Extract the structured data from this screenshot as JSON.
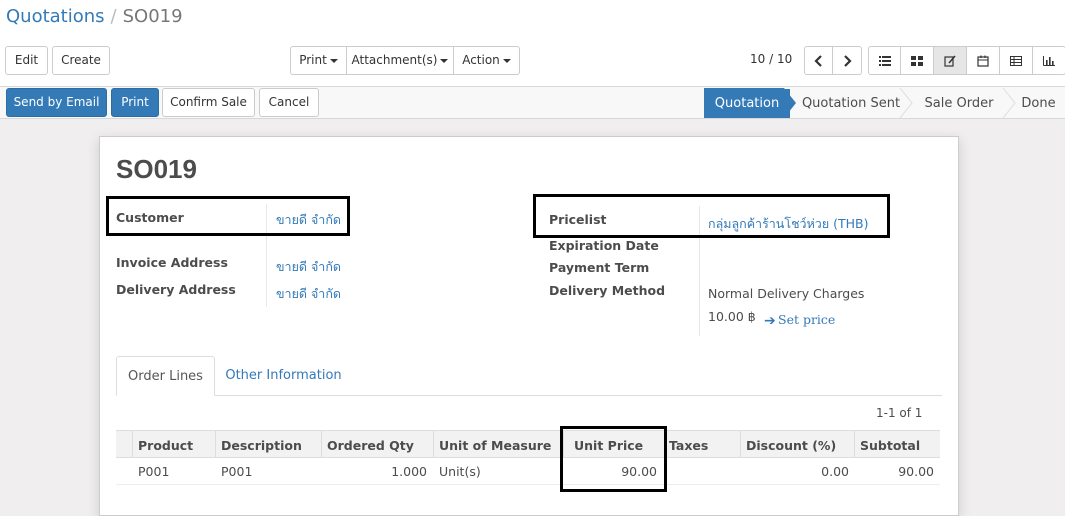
{
  "breadcrumb": {
    "parent": "Quotations",
    "separator": "/",
    "current": "SO019"
  },
  "toolbar": {
    "edit": "Edit",
    "create": "Create",
    "print": "Print",
    "attachments": "Attachment(s)",
    "action": "Action"
  },
  "pager": {
    "value": "10 / 10"
  },
  "views": [
    {
      "name": "list-view-icon"
    },
    {
      "name": "kanban-view-icon"
    },
    {
      "name": "form-view-icon"
    },
    {
      "name": "calendar-view-icon"
    },
    {
      "name": "pivot-view-icon"
    },
    {
      "name": "graph-view-icon"
    }
  ],
  "actions": {
    "send_by_email": "Send by Email",
    "print": "Print",
    "confirm_sale": "Confirm Sale",
    "cancel": "Cancel"
  },
  "statusbar": {
    "stages": [
      "Quotation",
      "Quotation Sent",
      "Sale Order",
      "Done"
    ],
    "active": "Quotation"
  },
  "form": {
    "title": "SO019",
    "customer_label": "Customer",
    "customer_value": "ขายดี จำกัด",
    "invoice_label": "Invoice Address",
    "invoice_value": "ขายดี จำกัด",
    "delivery_label": "Delivery Address",
    "delivery_value": "ขายดี จำกัด",
    "pricelist_label": "Pricelist",
    "pricelist_value": "กลุ่มลูกค้าร้านโชว์ห่วย (THB)",
    "expiration_label": "Expiration Date",
    "payment_term_label": "Payment Term",
    "delivery_method_label": "Delivery Method",
    "delivery_method_value": "Normal Delivery Charges",
    "delivery_price": "10.00 ฿",
    "set_price": "Set price"
  },
  "tabs": [
    "Order Lines",
    "Other Information"
  ],
  "lines_pager": "1-1 of 1",
  "table": {
    "headers": [
      "Product",
      "Description",
      "Ordered Qty",
      "Unit of Measure",
      "Unit Price",
      "Taxes",
      "Discount (%)",
      "Subtotal"
    ],
    "rows": [
      [
        "P001",
        "P001",
        "1.000",
        "Unit(s)",
        "90.00",
        "",
        "0.00",
        "90.00"
      ]
    ]
  },
  "colors": {
    "primary": "#337ab7",
    "link": "#337ab7",
    "highlight": "#000000"
  }
}
